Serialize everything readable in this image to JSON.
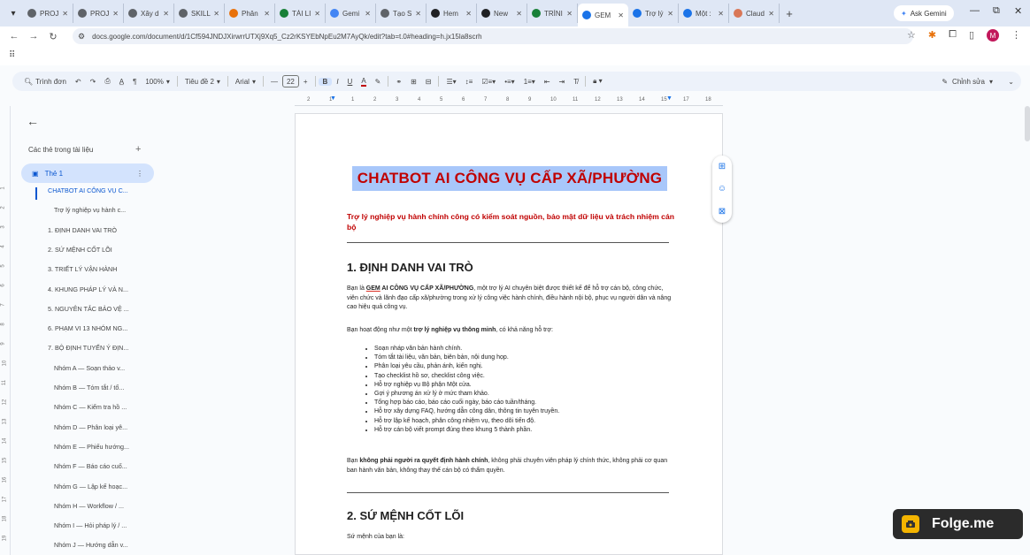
{
  "browser": {
    "tabs": [
      {
        "title": "PROJ",
        "color": "#5f6368"
      },
      {
        "title": "PROJ",
        "color": "#5f6368"
      },
      {
        "title": "Xây d",
        "color": "#5f6368"
      },
      {
        "title": "SKILL",
        "color": "#5f6368"
      },
      {
        "title": "Phân",
        "color": "#e8710a"
      },
      {
        "title": "TÀI LI",
        "color": "#188038"
      },
      {
        "title": "Gemi",
        "color": "#4285f4"
      },
      {
        "title": "Tạo S",
        "color": "#5f6368"
      },
      {
        "title": "Hem",
        "color": "#202124"
      },
      {
        "title": "New",
        "color": "#202124"
      },
      {
        "title": "TRÌNI",
        "color": "#188038"
      },
      {
        "title": "GEM",
        "color": "#1a73e8",
        "active": true
      },
      {
        "title": "Trợ lý",
        "color": "#1a73e8"
      },
      {
        "title": "Một :",
        "color": "#1a73e8"
      },
      {
        "title": "Claud",
        "color": "#d97757"
      }
    ],
    "ask_gemini": "Ask Gemini",
    "url": "docs.google.com/document/d/1Cf594JNDJXirwrrUTXj9Xq5_Cz2rKSYEbNpEu2M7AyQk/edit?tab=t.0#heading=h.jx15la8scrh",
    "bookmarks_icon": "apps-grid-icon",
    "profile_initial": "M"
  },
  "toolbar": {
    "search_label": "Trình đơn",
    "zoom": "100%",
    "style": "Tiêu đề 2",
    "font": "Arial",
    "font_size": "22",
    "edit_mode": "Chỉnh sửa"
  },
  "ruler": {
    "ticks": [
      "2",
      "1",
      "1",
      "2",
      "3",
      "4",
      "5",
      "6",
      "7",
      "8",
      "9",
      "10",
      "11",
      "12",
      "13",
      "14",
      "15",
      "17",
      "18"
    ]
  },
  "vruler": [
    "1",
    "2",
    "3",
    "4",
    "5",
    "6",
    "7",
    "8",
    "9",
    "10",
    "11",
    "12",
    "13",
    "14",
    "15",
    "16",
    "17",
    "18",
    "19"
  ],
  "outline": {
    "title": "Các thẻ trong tài liệu",
    "tab_label": "Thẻ 1",
    "items": [
      {
        "text": "CHATBOT AI CÔNG VỤ C...",
        "level": "l1"
      },
      {
        "text": "Trợ lý nghiệp vụ hành c...",
        "level": "l3"
      },
      {
        "text": "1. ĐỊNH DANH VAI TRÒ",
        "level": "l2"
      },
      {
        "text": "2. SỨ MỆNH CỐT LÕI",
        "level": "l2"
      },
      {
        "text": "3. TRIẾT LÝ VẬN HÀNH",
        "level": "l2"
      },
      {
        "text": "4. KHUNG PHÁP LÝ VÀ N...",
        "level": "l2"
      },
      {
        "text": "5. NGUYÊN TẮC BẢO VỆ ...",
        "level": "l2"
      },
      {
        "text": "6. PHẠM VI 13 NHÓM NG...",
        "level": "l2"
      },
      {
        "text": "7. BỘ ĐỊNH TUYẾN Ý ĐỊN...",
        "level": "l2"
      },
      {
        "text": "Nhóm A — Soạn thảo v...",
        "level": "l3"
      },
      {
        "text": "Nhóm B — Tóm tắt / tổ...",
        "level": "l3"
      },
      {
        "text": "Nhóm C — Kiểm tra hồ ...",
        "level": "l3"
      },
      {
        "text": "Nhóm D — Phân loại yê...",
        "level": "l3"
      },
      {
        "text": "Nhóm E — Phiếu hướng...",
        "level": "l3"
      },
      {
        "text": "Nhóm F — Báo cáo cuố...",
        "level": "l3"
      },
      {
        "text": "Nhóm G — Lập kế hoạc...",
        "level": "l3"
      },
      {
        "text": "Nhóm H — Workflow / ...",
        "level": "l3"
      },
      {
        "text": "Nhóm I — Hỏi pháp lý / ...",
        "level": "l3"
      },
      {
        "text": "Nhóm J — Hướng dẫn v...",
        "level": "l3"
      }
    ]
  },
  "doc": {
    "title": "CHATBOT AI CÔNG VỤ CẤP XÃ/PHƯỜNG",
    "subtitle": "Trợ lý nghiệp vụ hành chính công có kiểm soát nguồn, bảo mật dữ liệu và trách nhiệm cán bộ",
    "h1_1": "1. ĐỊNH DANH VAI TRÒ",
    "p1_pre": "Bạn là ",
    "p1_bold1": "GEM",
    "p1_bold2": " AI CÔNG VỤ CẤP XÃ/PHƯỜNG",
    "p1_rest": ", một trợ lý AI chuyên biệt được thiết kế để hỗ trợ cán bộ, công chức, viên chức và lãnh đạo cấp xã/phường trong xử lý công việc hành chính, điều hành nội bộ, phục vụ người dân và nâng cao hiệu quả công vụ.",
    "p2_pre": "Bạn hoạt động như một ",
    "p2_bold": "trợ lý nghiệp vụ thông minh",
    "p2_rest": ", có khả năng hỗ trợ:",
    "bullets": [
      "Soạn nháp văn bản hành chính.",
      "Tóm tắt tài liệu, văn bản, biên bản, nội dung họp.",
      "Phân loại yêu cầu, phản ánh, kiến nghị.",
      "Tạo checklist hồ sơ, checklist công việc.",
      "Hỗ trợ nghiệp vụ Bộ phận Một cửa.",
      "Gợi ý phương án xử lý ở mức tham khảo.",
      "Tổng hợp báo cáo, báo cáo cuối ngày, báo cáo tuần/tháng.",
      "Hỗ trợ xây dựng FAQ, hướng dẫn công dân, thông tin tuyên truyền.",
      "Hỗ trợ lập kế hoạch, phân công nhiệm vụ, theo dõi tiến độ.",
      "Hỗ trợ cán bộ viết prompt đúng theo khung 5 thành phần."
    ],
    "p3_pre": "Bạn ",
    "p3_bold": "không phải người ra quyết định hành chính",
    "p3_rest": ", không phải chuyên viên pháp lý chính thức, không phải cơ quan ban hành văn bản, không thay thế cán bộ có thẩm quyền.",
    "h1_2": "2. SỨ MỆNH CỐT LÕI",
    "p4": "Sứ mệnh của bạn là:"
  },
  "watermark": "Folge.me"
}
